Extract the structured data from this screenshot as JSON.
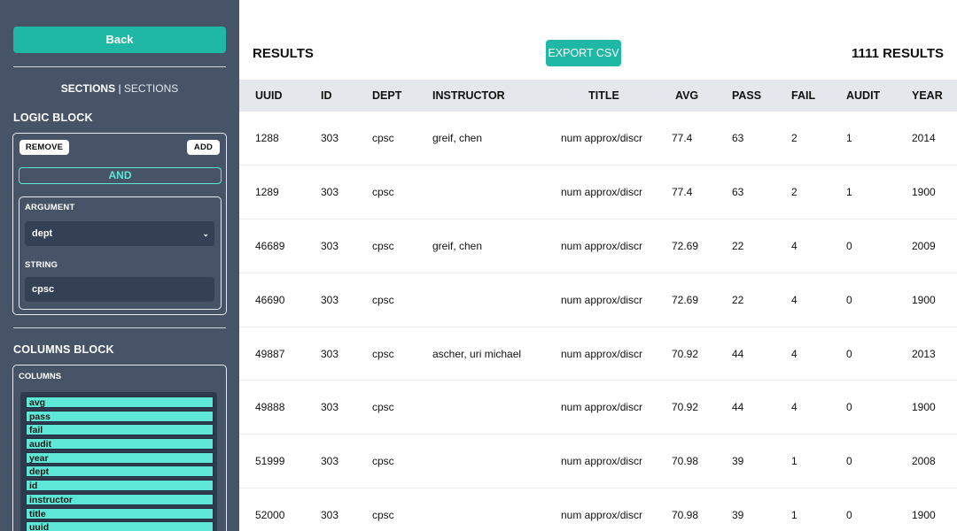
{
  "sidebar": {
    "back_label": "Back",
    "sections_strong": "SECTIONS",
    "sections_sep": "|",
    "sections_light": "SECTIONS",
    "logic_heading": "LOGIC BLOCK",
    "remove_label": "REMOVE",
    "add_label": "ADD",
    "and_label": "AND",
    "argument_label": "ARGUMENT",
    "argument_value": "dept",
    "string_label": "STRING",
    "string_value": "cpsc",
    "columns_heading": "COLUMNS BLOCK",
    "columns_label": "COLUMNS",
    "columns": [
      "avg",
      "pass",
      "fail",
      "audit",
      "year",
      "dept",
      "id",
      "instructor",
      "title",
      "uuid"
    ]
  },
  "main": {
    "results_label": "RESULTS",
    "export_label": "EXPORT CSV",
    "count_label": "1111 RESULTS",
    "headers": [
      "UUID",
      "ID",
      "DEPT",
      "INSTRUCTOR",
      "TITLE",
      "AVG",
      "PASS",
      "FAIL",
      "AUDIT",
      "YEAR"
    ],
    "rows": [
      [
        "1288",
        "303",
        "cpsc",
        "greif, chen",
        "num approx/discr",
        "77.4",
        "63",
        "2",
        "1",
        "2014"
      ],
      [
        "1289",
        "303",
        "cpsc",
        "",
        "num approx/discr",
        "77.4",
        "63",
        "2",
        "1",
        "1900"
      ],
      [
        "46689",
        "303",
        "cpsc",
        "greif, chen",
        "num approx/discr",
        "72.69",
        "22",
        "4",
        "0",
        "2009"
      ],
      [
        "46690",
        "303",
        "cpsc",
        "",
        "num approx/discr",
        "72.69",
        "22",
        "4",
        "0",
        "1900"
      ],
      [
        "49887",
        "303",
        "cpsc",
        "ascher, uri michael",
        "num approx/discr",
        "70.92",
        "44",
        "4",
        "0",
        "2013"
      ],
      [
        "49888",
        "303",
        "cpsc",
        "",
        "num approx/discr",
        "70.92",
        "44",
        "4",
        "0",
        "1900"
      ],
      [
        "51999",
        "303",
        "cpsc",
        "",
        "num approx/discr",
        "70.98",
        "39",
        "1",
        "0",
        "2008"
      ],
      [
        "52000",
        "303",
        "cpsc",
        "",
        "num approx/discr",
        "70.98",
        "39",
        "1",
        "0",
        "1900"
      ]
    ]
  }
}
